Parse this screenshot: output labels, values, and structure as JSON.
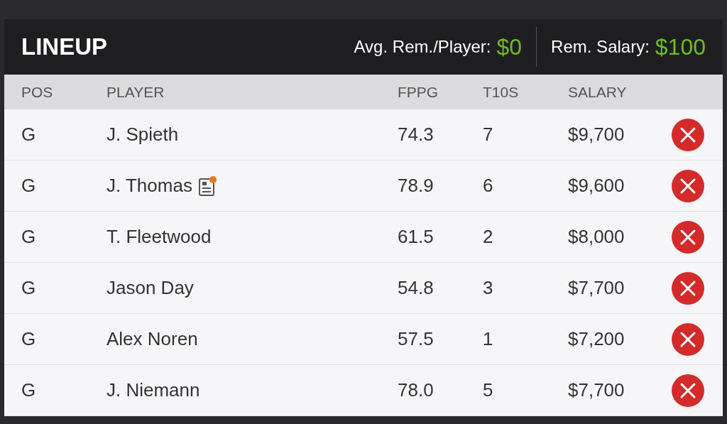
{
  "title": "LINEUP",
  "stats": [
    {
      "label": "Avg. Rem./Player:",
      "value": "$0"
    },
    {
      "label": "Rem. Salary:",
      "value": "$100"
    }
  ],
  "columns": [
    "POS",
    "PLAYER",
    "FPPG",
    "T10S",
    "SALARY"
  ],
  "rows": [
    {
      "pos": "G",
      "player": "J. Spieth",
      "news": false,
      "fppg": "74.3",
      "t10s": "7",
      "salary": "$9,700"
    },
    {
      "pos": "G",
      "player": "J. Thomas",
      "news": true,
      "fppg": "78.9",
      "t10s": "6",
      "salary": "$9,600"
    },
    {
      "pos": "G",
      "player": "T. Fleetwood",
      "news": false,
      "fppg": "61.5",
      "t10s": "2",
      "salary": "$8,000"
    },
    {
      "pos": "G",
      "player": "Jason Day",
      "news": false,
      "fppg": "54.8",
      "t10s": "3",
      "salary": "$7,700"
    },
    {
      "pos": "G",
      "player": "Alex Noren",
      "news": false,
      "fppg": "57.5",
      "t10s": "1",
      "salary": "$7,200"
    },
    {
      "pos": "G",
      "player": "J. Niemann",
      "news": false,
      "fppg": "78.0",
      "t10s": "5",
      "salary": "$7,700"
    }
  ]
}
